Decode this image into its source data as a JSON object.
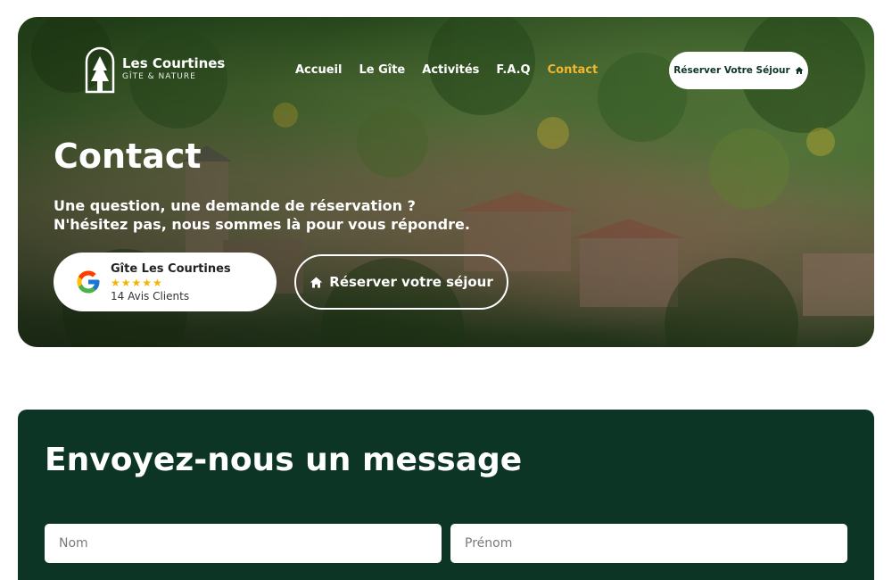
{
  "brand": {
    "name": "Les Courtines",
    "tagline": "GÎTE & NATURE",
    "logo_icon": "house-tree-logo"
  },
  "nav": {
    "items": [
      {
        "label": "Accueil",
        "active": false
      },
      {
        "label": "Le Gîte",
        "active": false
      },
      {
        "label": "Activités",
        "active": false
      },
      {
        "label": "F.A.Q",
        "active": false
      },
      {
        "label": "Contact",
        "active": true
      }
    ],
    "cta_label": "Réserver Votre Séjour",
    "cta_icon": "home-icon"
  },
  "hero": {
    "title": "Contact",
    "subtitle_line1": "Une question, une demande de réservation ?",
    "subtitle_line2": "N'hésitez pas, nous sommes là pour vous répondre.",
    "review": {
      "name": "Gîte Les Courtines",
      "stars": "★★★★★",
      "rating": 5,
      "count_label": "14 Avis Clients",
      "icon": "google-icon"
    },
    "cta_label": "Réserver votre séjour",
    "cta_icon": "home-icon"
  },
  "form": {
    "title": "Envoyez-nous un message",
    "fields": {
      "nom_placeholder": "Nom",
      "prenom_placeholder": "Prénom"
    }
  },
  "colors": {
    "accent": "#f2b631",
    "dark_green": "#0c3526",
    "white": "#ffffff"
  }
}
